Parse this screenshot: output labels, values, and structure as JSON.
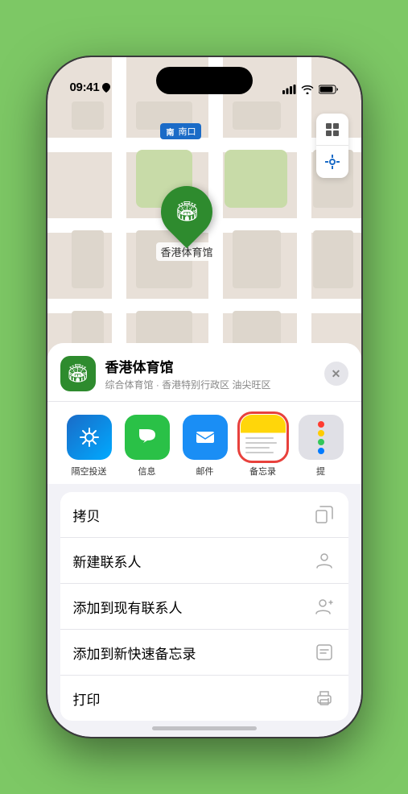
{
  "status": {
    "time": "09:41",
    "location_arrow": true
  },
  "map": {
    "subway_label": "南口",
    "pin_label": "香港体育馆"
  },
  "sheet": {
    "venue_name": "香港体育馆",
    "venue_subtitle": "综合体育馆 · 香港特别行政区 油尖旺区",
    "close_label": "×"
  },
  "share_items": [
    {
      "id": "airdrop",
      "label": "隔空投送",
      "selected": false
    },
    {
      "id": "messages",
      "label": "信息",
      "selected": false
    },
    {
      "id": "mail",
      "label": "邮件",
      "selected": false
    },
    {
      "id": "notes",
      "label": "备忘录",
      "selected": true
    },
    {
      "id": "more",
      "label": "提",
      "selected": false
    }
  ],
  "actions": [
    {
      "id": "copy",
      "label": "拷贝",
      "icon": "copy"
    },
    {
      "id": "add-contact",
      "label": "新建联系人",
      "icon": "person"
    },
    {
      "id": "add-existing",
      "label": "添加到现有联系人",
      "icon": "person-add"
    },
    {
      "id": "add-note",
      "label": "添加到新快速备忘录",
      "icon": "note"
    },
    {
      "id": "print",
      "label": "打印",
      "icon": "print"
    }
  ]
}
